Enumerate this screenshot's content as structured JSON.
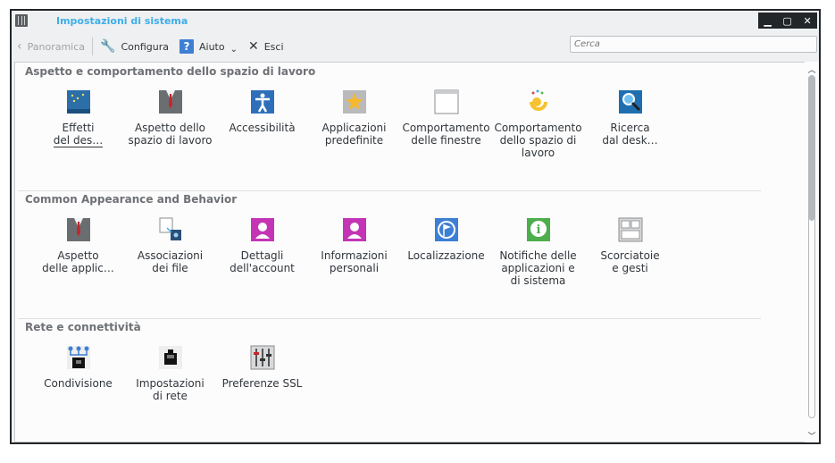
{
  "window": {
    "title": "Impostazioni di sistema",
    "controls": [
      "▁",
      "▢",
      "✕"
    ]
  },
  "toolbar": {
    "back_label": "Panoramica",
    "configure_label": "Configura",
    "help_label": "Aiuto",
    "quit_label": "Esci"
  },
  "search": {
    "placeholder": "Cerca"
  },
  "categories": [
    {
      "title": "Aspetto e comportamento dello spazio di lavoro",
      "items": [
        {
          "label": "Effetti\ndel des…",
          "icon": "desktop-effects-icon"
        },
        {
          "label": "Aspetto dello\nspazio di lavoro",
          "icon": "workspace-theme-icon"
        },
        {
          "label": "Accessibilità",
          "icon": "accessibility-icon"
        },
        {
          "label": "Applicazioni\npredefinite",
          "icon": "default-apps-icon"
        },
        {
          "label": "Comportamento\ndelle finestre",
          "icon": "window-behaviour-icon"
        },
        {
          "label": "Comportamento\ndello spazio di\nlavoro",
          "icon": "workspace-behaviour-icon"
        },
        {
          "label": "Ricerca\ndal desk…",
          "icon": "desktop-search-icon"
        }
      ]
    },
    {
      "title": "Common Appearance and Behavior",
      "items": [
        {
          "label": "Aspetto\ndelle applic…",
          "icon": "app-appearance-icon"
        },
        {
          "label": "Associazioni\ndei file",
          "icon": "file-associations-icon"
        },
        {
          "label": "Dettagli\ndell'account",
          "icon": "account-details-icon"
        },
        {
          "label": "Informazioni\npersonali",
          "icon": "personal-info-icon"
        },
        {
          "label": "Localizzazione",
          "icon": "localization-icon"
        },
        {
          "label": "Notifiche delle\napplicazioni e\ndi sistema",
          "icon": "notifications-icon"
        },
        {
          "label": "Scorciatoie\ne gesti",
          "icon": "shortcuts-icon"
        }
      ]
    },
    {
      "title": "Rete e connettività",
      "items": [
        {
          "label": "Condivisione",
          "icon": "sharing-icon"
        },
        {
          "label": "Impostazioni\ndi rete",
          "icon": "network-settings-icon"
        },
        {
          "label": "Preferenze SSL",
          "icon": "ssl-preferences-icon"
        }
      ]
    }
  ],
  "colors": {
    "accent": "#3daee9",
    "titlebar_buttons": "#232629"
  }
}
